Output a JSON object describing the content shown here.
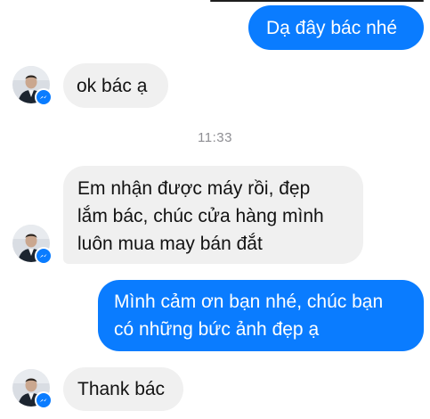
{
  "conversation": {
    "timestamp": "11:33",
    "messages": [
      {
        "id": "msg-1",
        "direction": "sent",
        "lines": [
          "Dạ đây bác nhé"
        ]
      },
      {
        "id": "msg-2",
        "direction": "received",
        "lines": [
          "ok bác ạ"
        ]
      },
      {
        "id": "msg-3",
        "direction": "received",
        "lines": [
          "Em nhận được máy rồi, đẹp",
          "lắm bác, chúc cửa hàng mình",
          "luôn mua may bán đắt"
        ]
      },
      {
        "id": "msg-4",
        "direction": "sent",
        "lines": [
          "Mình cảm ơn bạn nhé, chúc bạn",
          "có những bức ảnh đẹp ạ"
        ]
      },
      {
        "id": "msg-5",
        "direction": "received",
        "lines": [
          "Thank bác"
        ]
      }
    ]
  },
  "colors": {
    "sent_bubble": "#0a7cff",
    "received_bubble": "#f0f0f0",
    "timestamp_text": "#8e8e93",
    "messenger_badge": "#0a7cff"
  },
  "icons": {
    "avatar": "contact-avatar",
    "badge": "messenger-icon"
  }
}
